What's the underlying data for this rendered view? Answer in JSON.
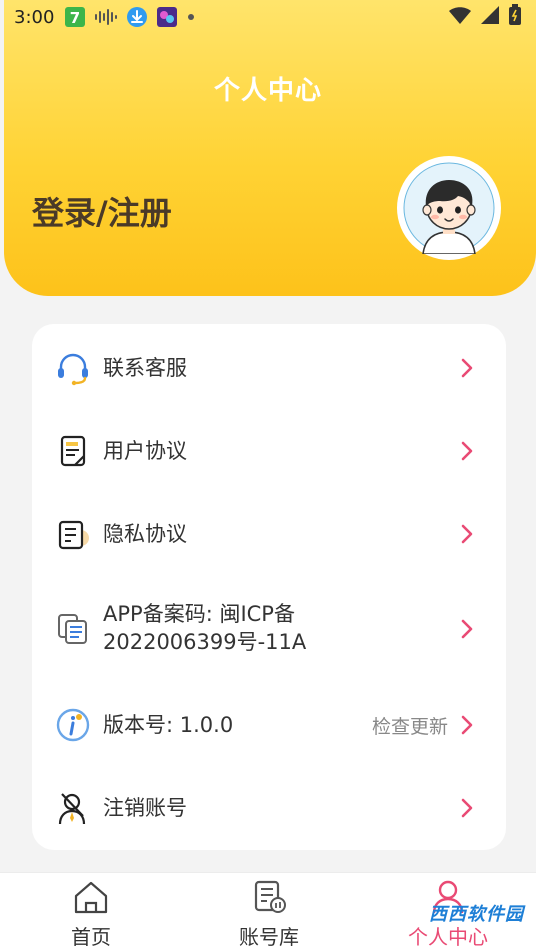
{
  "status_bar": {
    "time": "3:00",
    "badge_text": "7",
    "icons": [
      "notification-7-icon",
      "audio-wave-icon",
      "download-icon",
      "app-thumbnail-icon",
      "dot-icon",
      "wifi-icon",
      "signal-icon",
      "battery-icon"
    ]
  },
  "header": {
    "title": "个人中心",
    "login_label": "登录/注册",
    "colors": {
      "gradient_top": "#ffe46b",
      "gradient_bottom": "#fdc21a",
      "title": "#ffffff"
    }
  },
  "menu": {
    "items": [
      {
        "label": "联系客服",
        "icon": "headset-icon"
      },
      {
        "label": "用户协议",
        "icon": "document-icon"
      },
      {
        "label": "隐私协议",
        "icon": "privacy-doc-icon"
      },
      {
        "label_line1": "APP备案码: 闽ICP备",
        "label_line2": "2022006399号-11A",
        "icon": "copy-doc-icon"
      },
      {
        "label": "版本号: 1.0.0",
        "icon": "info-icon",
        "extra": "检查更新"
      },
      {
        "label": "注销账号",
        "icon": "user-cancel-icon"
      }
    ],
    "arrow_color": "#e94a74"
  },
  "bottom_nav": {
    "items": [
      {
        "label": "首页",
        "icon": "home-icon"
      },
      {
        "label": "账号库",
        "icon": "account-library-icon"
      },
      {
        "label": "个人中心",
        "icon": "profile-icon",
        "active": true
      }
    ],
    "active_color": "#e94a74"
  },
  "watermark": "西西软件园"
}
